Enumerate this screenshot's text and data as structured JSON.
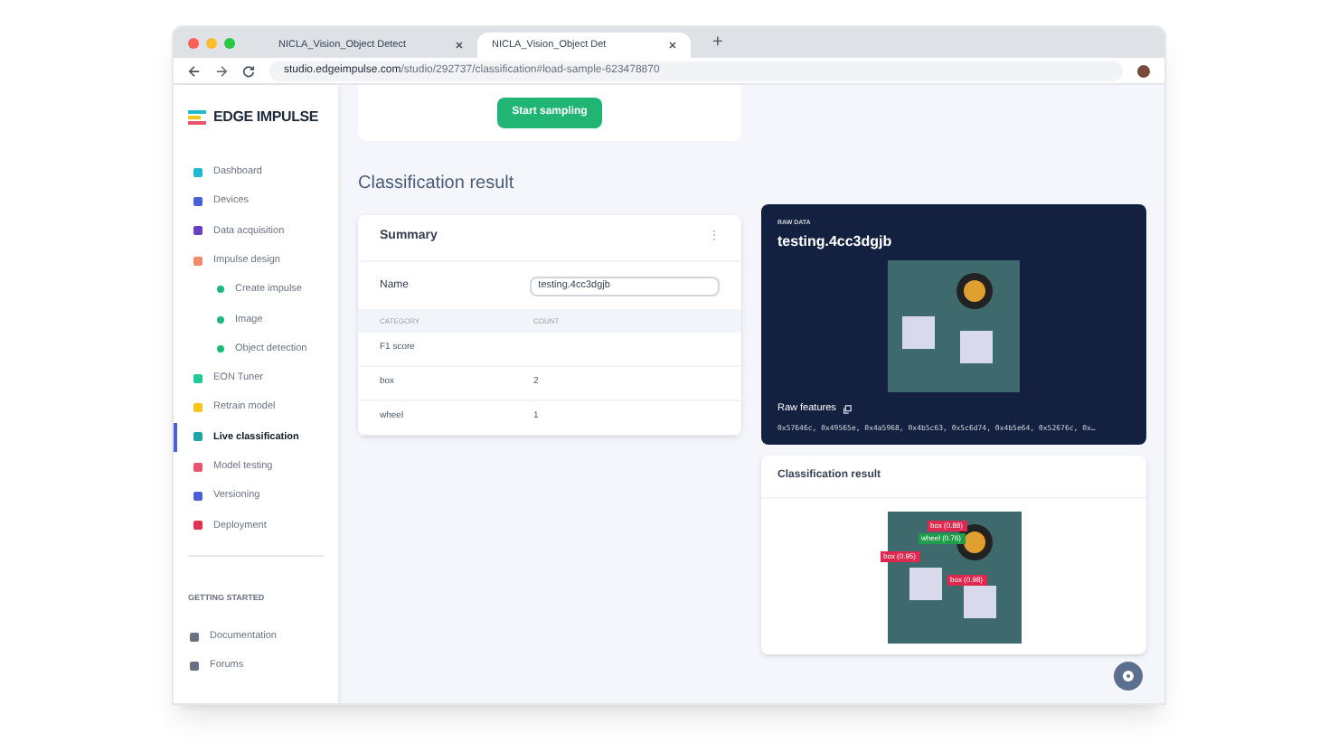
{
  "browser": {
    "tabs": [
      {
        "title": "NICLA_Vision_Object Detect",
        "selected": false
      },
      {
        "title": "NICLA_Vision_Object Det",
        "selected": true
      }
    ],
    "new_tab": "+",
    "url_host": "studio.edgeimpulse.com",
    "url_path": "/studio/292737/classification#load-sample-623478870"
  },
  "sidebar": {
    "logo": "EDGE IMPULSE",
    "items": [
      {
        "label": "Dashboard",
        "color": "#22b8cf",
        "selected": false
      },
      {
        "label": "Devices",
        "color": "#4c5fd5",
        "selected": false
      },
      {
        "label": "Data acquisition",
        "color": "#6b3fc4",
        "selected": false
      },
      {
        "label": "Impulse design",
        "color": "#f08c6c",
        "selected": false,
        "children": [
          {
            "label": "Create impulse",
            "color": "#1db87a",
            "selected": false
          },
          {
            "label": "Image",
            "color": "#1db87a",
            "selected": false
          },
          {
            "label": "Object detection",
            "color": "#1db87a",
            "selected": false
          }
        ]
      },
      {
        "label": "EON Tuner",
        "color": "#20c997",
        "selected": false
      },
      {
        "label": "Retrain model",
        "color": "#f5c518",
        "selected": false
      },
      {
        "label": "Live classification",
        "color": "#20a4a4",
        "selected": true
      },
      {
        "label": "Model testing",
        "color": "#e8546b",
        "selected": false
      },
      {
        "label": "Versioning",
        "color": "#4c5fd5",
        "selected": false
      },
      {
        "label": "Deployment",
        "color": "#e03150",
        "selected": false
      }
    ],
    "section": "GETTING STARTED",
    "links": [
      {
        "label": "Documentation"
      },
      {
        "label": "Forums"
      }
    ]
  },
  "main": {
    "start_button": "Start sampling",
    "heading": "Classification result",
    "summary": {
      "title": "Summary",
      "menu": "⋮",
      "name_label": "Name",
      "name_value": "testing.4cc3dgjb",
      "columns": [
        "CATEGORY",
        "COUNT"
      ],
      "rows": [
        {
          "category": "F1 score",
          "count": ""
        },
        {
          "category": "box",
          "count": "2"
        },
        {
          "category": "wheel",
          "count": "1"
        }
      ]
    },
    "raw": {
      "caption": "RAW DATA",
      "title": "testing.4cc3dgjb",
      "features_label": "Raw features",
      "features": "0x57646c, 0x49565e, 0x4a5968, 0x4b5c63, 0x5c6d74, 0x4b5e64, 0x52676c, 0x…"
    },
    "result": {
      "title": "Classification result",
      "detections": [
        {
          "label": "box (0.88)",
          "color": "#e0284f"
        },
        {
          "label": "wheel (0.76)",
          "color": "#1f9d4a"
        },
        {
          "label": "box (0.95)",
          "color": "#e0284f"
        },
        {
          "label": "box (0.98)",
          "color": "#e0284f"
        }
      ]
    }
  }
}
